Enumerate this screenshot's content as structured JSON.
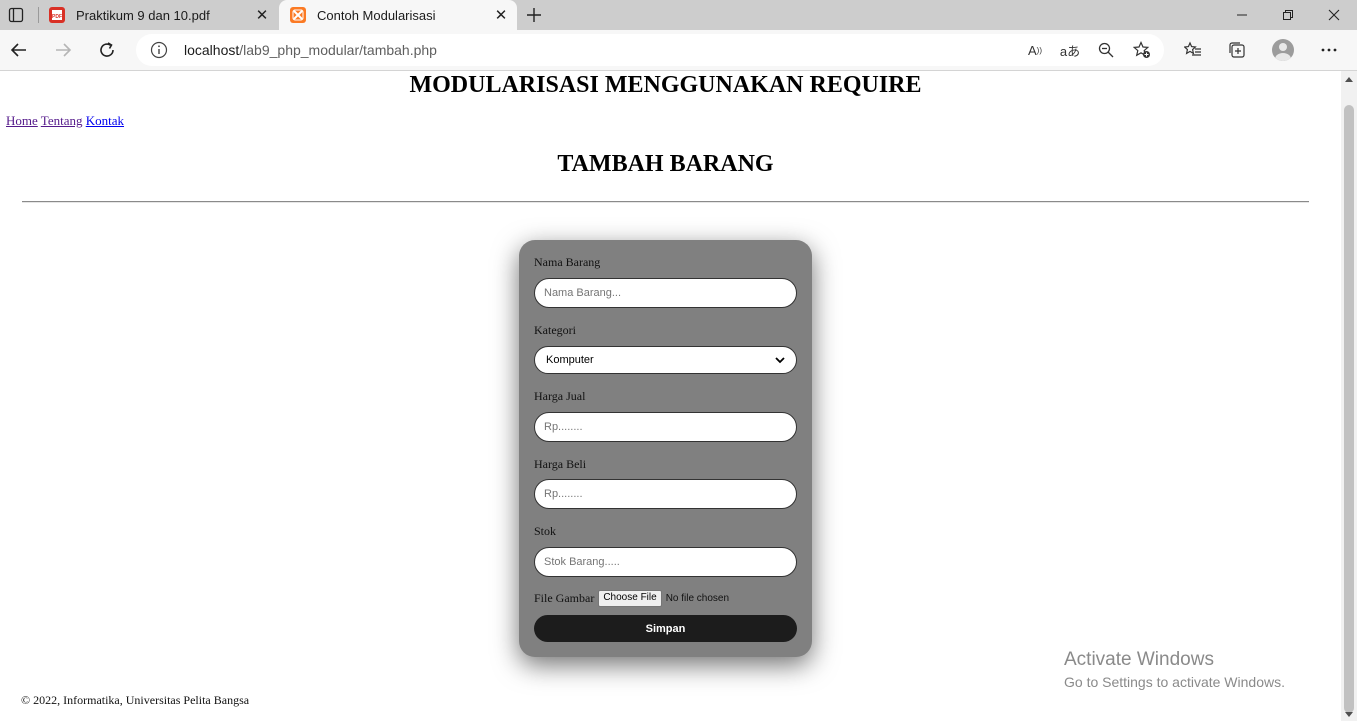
{
  "browser": {
    "tabs": [
      {
        "title": "Praktikum 9 dan 10.pdf",
        "icon": "pdf-icon",
        "active": false
      },
      {
        "title": "Contoh Modularisasi",
        "icon": "xampp-icon",
        "active": true
      }
    ],
    "url": {
      "host": "localhost",
      "path": "/lab9_php_modular/tambah.php"
    }
  },
  "page": {
    "site_title": "MODULARISASI MENGGUNAKAN REQUIRE",
    "nav": [
      "Home",
      "Tentang",
      "Kontak"
    ],
    "heading": "TAMBAH BARANG",
    "form": {
      "nama_label": "Nama Barang",
      "nama_placeholder": "Nama Barang...",
      "kategori_label": "Kategori",
      "kategori_selected": "Komputer",
      "harga_jual_label": "Harga Jual",
      "harga_jual_placeholder": "Rp........",
      "harga_beli_label": "Harga Beli",
      "harga_beli_placeholder": "Rp........",
      "stok_label": "Stok",
      "stok_placeholder": "Stok Barang.....",
      "file_label": "File Gambar",
      "file_button": "Choose File",
      "file_status": "No file chosen",
      "submit_label": "Simpan"
    },
    "footer": "© 2022, Informatika, Universitas Pelita Bangsa"
  },
  "os_watermark": {
    "title": "Activate Windows",
    "subtitle": "Go to Settings to activate Windows."
  },
  "colors": {
    "form_bg": "#808080",
    "submit_bg": "#1c1c1c",
    "link": "#0000ee",
    "link_visited": "#551a8b"
  }
}
